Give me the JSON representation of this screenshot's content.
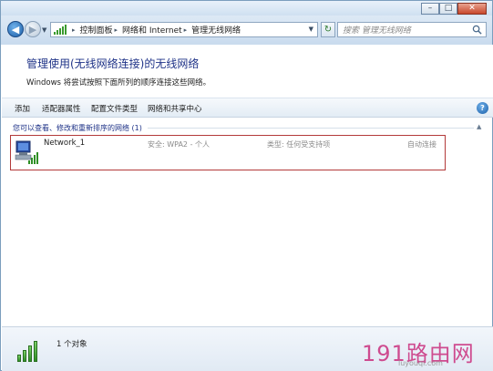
{
  "window": {
    "controls": {
      "minimize": "–",
      "maximize": "□",
      "close": "✕"
    }
  },
  "nav": {
    "back_glyph": "◀",
    "forward_glyph": "▶",
    "dropdown_glyph": "▼",
    "breadcrumbs": [
      "控制面板",
      "网络和 Internet",
      "管理无线网络"
    ],
    "crumb_separator": "▸",
    "refresh_glyph": "↻",
    "search_placeholder": "搜索 管理无线网络"
  },
  "header": {
    "title": "管理使用(无线网络连接)的无线网络",
    "description": "Windows 将尝试按照下面所列的顺序连接这些网络。"
  },
  "toolbar": {
    "items": [
      "添加",
      "适配器属性",
      "配置文件类型",
      "网络和共享中心"
    ],
    "help_glyph": "?"
  },
  "list": {
    "group_header": "您可以查看、修改和重新排序的网络 (1)",
    "group_chevron": "▲",
    "networks": [
      {
        "name": "Network_1",
        "security": "安全: WPA2 - 个人",
        "type": "类型: 任何受支持项",
        "mode": "自动连接"
      }
    ]
  },
  "details": {
    "item_count": "1 个对象"
  },
  "watermark": {
    "brand": "191路由网",
    "domain": "luyouqi.com"
  },
  "colors": {
    "title": "#1e3287",
    "selection_border": "#b33a3a",
    "watermark": "#cc3a84"
  }
}
